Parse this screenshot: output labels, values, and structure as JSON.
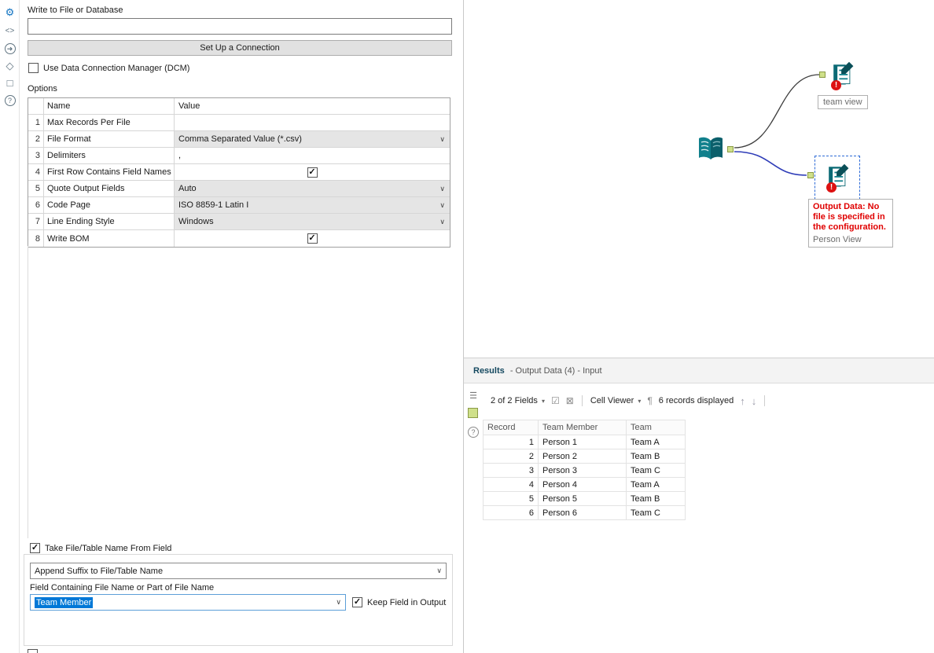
{
  "icons": {
    "gear": "⚙",
    "code": "<>",
    "share_arrow": "➜",
    "tag": "◇",
    "box": "□",
    "question": "?",
    "check": "✓",
    "chevron": "∨",
    "caret": "▾",
    "select_all": "☑",
    "deselect": "⊠",
    "pilcrow": "¶",
    "arrow_up": "↑",
    "arrow_down": "↓",
    "list": "☰",
    "exclamation": "!"
  },
  "config": {
    "title": "Write to File or Database",
    "file_input": {
      "value": "",
      "placeholder": ""
    },
    "setup_button": "Set Up a Connection",
    "dcm_label": "Use Data Connection Manager (DCM)",
    "dcm_checked": false,
    "options_label": "Options",
    "options_table": {
      "headers": [
        "Name",
        "Value"
      ],
      "rows": [
        {
          "num": "1",
          "name": "Max Records Per File",
          "type": "text",
          "value": ""
        },
        {
          "num": "2",
          "name": "File Format",
          "type": "dropdown",
          "value": "Comma Separated Value (*.csv)"
        },
        {
          "num": "3",
          "name": "Delimiters",
          "type": "text",
          "value": ","
        },
        {
          "num": "4",
          "name": "First Row Contains Field Names",
          "type": "checkbox",
          "checked": true
        },
        {
          "num": "5",
          "name": "Quote Output Fields",
          "type": "dropdown",
          "value": "Auto"
        },
        {
          "num": "6",
          "name": "Code Page",
          "type": "dropdown",
          "value": "ISO 8859-1 Latin I"
        },
        {
          "num": "7",
          "name": "Line Ending Style",
          "type": "dropdown",
          "value": "Windows"
        },
        {
          "num": "8",
          "name": "Write BOM",
          "type": "checkbox",
          "checked": true
        }
      ]
    },
    "take_name_label": "Take File/Table Name From Field",
    "take_name_checked": true,
    "suffix_dropdown_value": "Append Suffix to File/Table Name",
    "field_label": "Field Containing File Name or Part of File Name",
    "field_dropdown_value": "Team Member",
    "keep_field_label": "Keep Field in Output",
    "keep_field_checked": true
  },
  "canvas": {
    "team_view_label": "team view",
    "error_text": "Output Data: No file is specified in the configuration.",
    "person_view_label": "Person View"
  },
  "results": {
    "title": "Results",
    "subtitle": "- Output Data (4) - Input",
    "toolbar": {
      "fields": "2 of 2 Fields",
      "cell_viewer": "Cell Viewer",
      "records": "6 records displayed"
    },
    "table": {
      "headers": [
        "Record",
        "Team Member",
        "Team"
      ],
      "rows": [
        [
          "1",
          "Person 1",
          "Team A"
        ],
        [
          "2",
          "Person 2",
          "Team B"
        ],
        [
          "3",
          "Person 3",
          "Team C"
        ],
        [
          "4",
          "Person 4",
          "Team A"
        ],
        [
          "5",
          "Person 5",
          "Team B"
        ],
        [
          "6",
          "Person 6",
          "Team C"
        ]
      ]
    }
  },
  "colors": {
    "accent": "#0078d7",
    "error": "#e00000",
    "teal": "#0c6f7a"
  }
}
